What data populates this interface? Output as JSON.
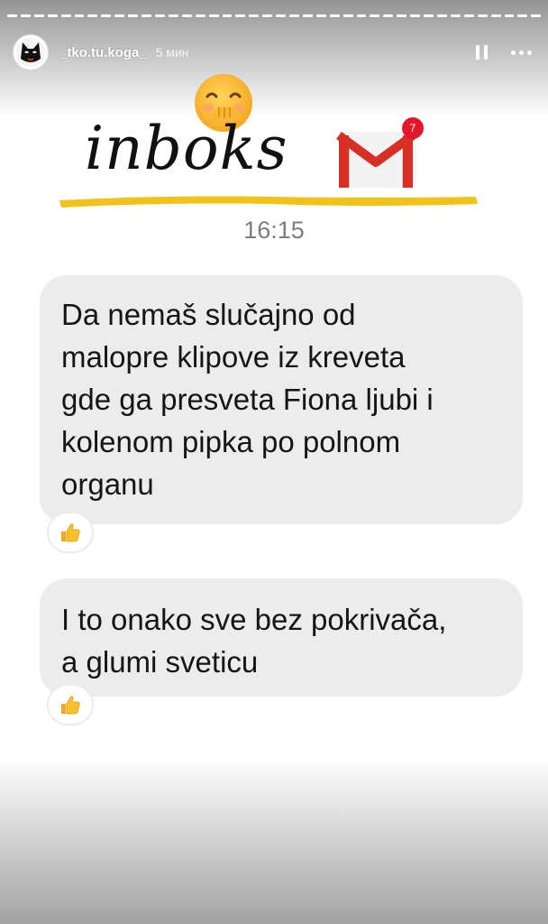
{
  "story": {
    "progress_segments": 40,
    "username": "_tko.tu.koga_",
    "time_ago": "5 мин"
  },
  "header_icons": {
    "avatar": "cat-mask-avatar-icon",
    "pause": "pause-icon",
    "more": "more-dots-icon"
  },
  "title": {
    "emoji": "face-with-hand-over-mouth-icon",
    "text": "inboks",
    "mail_icon": "gmail-icon",
    "badge_count": "7"
  },
  "colors": {
    "badge": "#e3182d",
    "underline": "#f2c21b",
    "bubble": "#ececec",
    "gmail_red": "#d93025"
  },
  "chat": {
    "timestamp": "16:15",
    "messages": [
      {
        "text": "Da nemaš slučajno od\nmalopre klipove iz kreveta\ngde ga presveta Fiona ljubi i\nkolenom pipka po polnom\norganu",
        "reaction": "thumbs-up-icon"
      },
      {
        "text": "I to onako sve bez pokrivača,\na glumi sveticu",
        "reaction": "thumbs-up-icon"
      }
    ]
  }
}
